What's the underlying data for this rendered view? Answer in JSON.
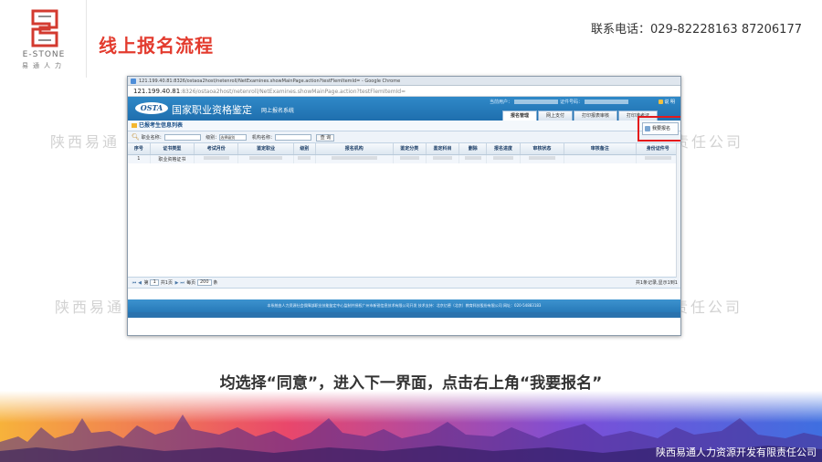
{
  "slide": {
    "brand": "E-STONE",
    "brand_sub": "易通人力",
    "title": "线上报名流程",
    "contact_label": "联系电话：",
    "contact_phones": "029-82228163 87206177",
    "watermark": "陕西易通",
    "watermark_right": "责任公司",
    "instruction": "均选择“同意”，进入下一界面，点击右上角“我要报名”",
    "company": "陕西易通人力资源开发有限责任公司",
    "colors": {
      "title": "#e33b2e",
      "accent_red": "#e4191c",
      "header_blue": "#2f89c8"
    }
  },
  "browser": {
    "window_title": "121.199.40.81:8326/ostaoa2host/netenroll/NetExamines.showMainPage.action?testFlemItemId= - Google Chrome",
    "url_host": "121.199.40.81",
    "url_path": ":8326/ostaoa2host/netenroll/NetExamines.showMainPage.action?testFlemItemId=",
    "app": {
      "logo_text": "OSTA",
      "name": "国家职业资格鉴定",
      "subtitle": "网上报名系统",
      "user_label": "当前用户：",
      "cert_label": "证件号码：",
      "help": "说 明",
      "tabs": [
        "报名管理",
        "网上支付",
        "打印报表审核",
        "打印准考证"
      ]
    },
    "panel": {
      "title": "已报考生信息列表",
      "enroll_button": "我要报名"
    },
    "filters": {
      "occupation_label": "职业名称：",
      "level_label": "级别：",
      "level_select": "选择级别",
      "org_label": "机构名称：",
      "query_button": "查 询"
    },
    "table": {
      "columns": [
        "序号",
        "证书类型",
        "考试月份",
        "鉴定职业",
        "级别",
        "报名机构",
        "鉴定分类",
        "鉴定科目",
        "删除",
        "报名进度",
        "审核状态",
        "审核备注",
        "身份证件号"
      ],
      "rows": [
        {
          "index": "1",
          "cert_type": "职业资格证书"
        }
      ]
    },
    "pager": {
      "page_prefix": "第",
      "page_value": "1",
      "page_suffix": "共1页",
      "per_page_label": "每页",
      "per_page_value": "200",
      "per_page_unit": "条",
      "summary": "共1条记录,显示1到1"
    },
    "footer": "本系统由人力资源社会保障部职业技能鉴定中心监制并授权广州市新锐信息技术有限公司开发 技术支持：北京亿德（北京）教育科技股份有限公司 网址：020-54883183"
  }
}
